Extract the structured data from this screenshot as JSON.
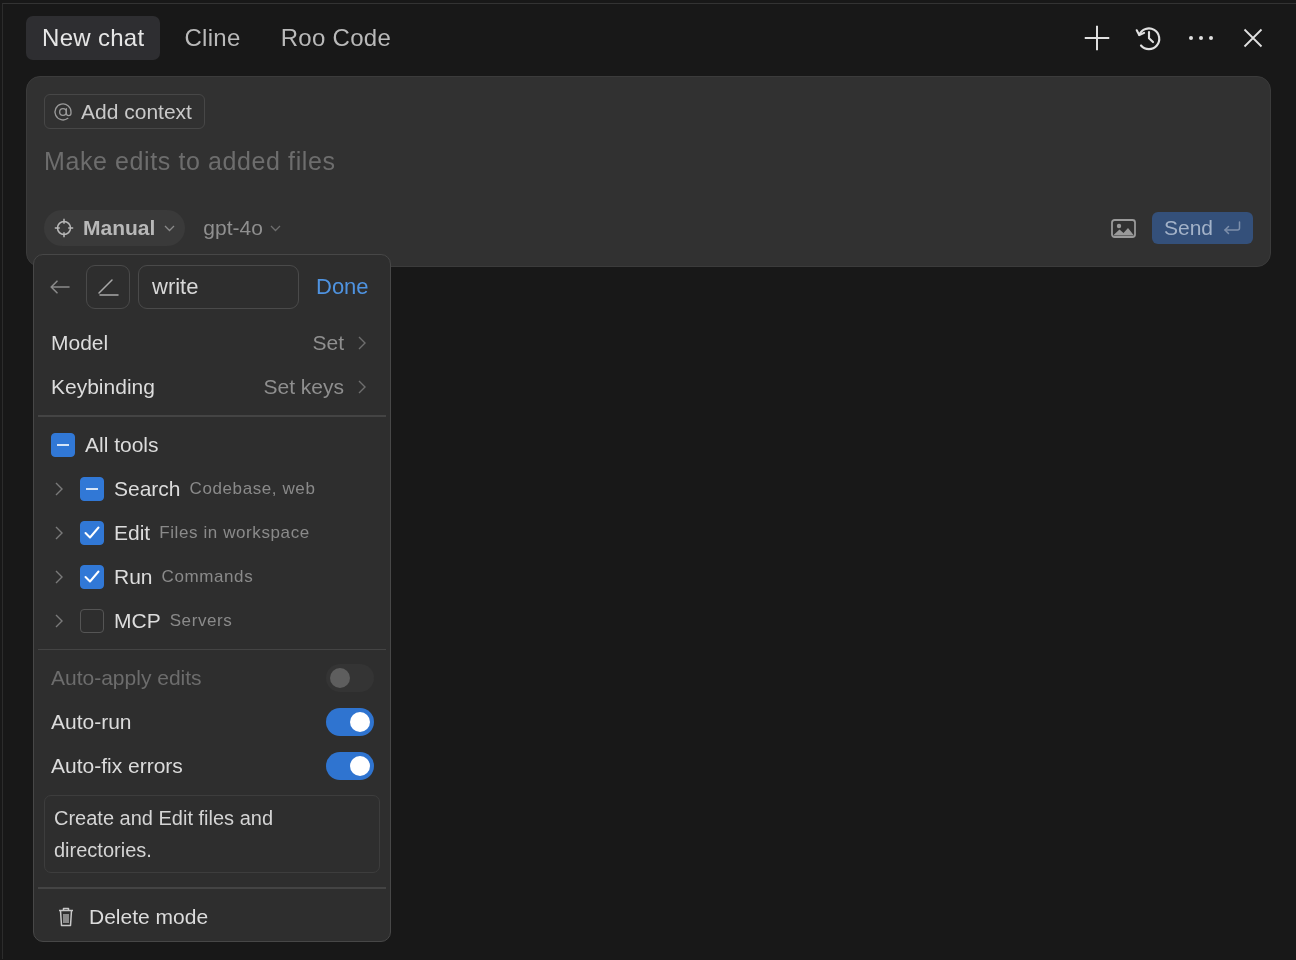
{
  "tabs": [
    {
      "label": "New chat",
      "selected": true
    },
    {
      "label": "Cline",
      "selected": false
    },
    {
      "label": "Roo Code",
      "selected": false
    }
  ],
  "composer": {
    "context_chip": "Add context",
    "placeholder": "Make edits to added files",
    "mode": "Manual",
    "model": "gpt-4o",
    "send": "Send"
  },
  "mode_menu": {
    "name_value": "write",
    "done": "Done",
    "settings": [
      {
        "label": "Model",
        "value": "Set"
      },
      {
        "label": "Keybinding",
        "value": "Set keys"
      }
    ],
    "all_tools": {
      "label": "All tools",
      "checked": true,
      "partial": true
    },
    "tools": [
      {
        "name": "Search",
        "description": "Codebase, web",
        "checked": true,
        "partial": true,
        "expanded": false
      },
      {
        "name": "Edit",
        "description": "Files in workspace",
        "checked": true,
        "partial": false,
        "expanded": false
      },
      {
        "name": "Run",
        "description": "Commands",
        "checked": true,
        "partial": false,
        "expanded": false
      },
      {
        "name": "MCP",
        "description": "Servers",
        "checked": false,
        "partial": false,
        "expanded": false
      }
    ],
    "options": [
      {
        "label": "Auto-apply edits",
        "on": false,
        "disabled": true
      },
      {
        "label": "Auto-run",
        "on": true,
        "disabled": false
      },
      {
        "label": "Auto-fix errors",
        "on": true,
        "disabled": false
      }
    ],
    "description": "Create and Edit files and directories.",
    "delete": "Delete mode"
  }
}
